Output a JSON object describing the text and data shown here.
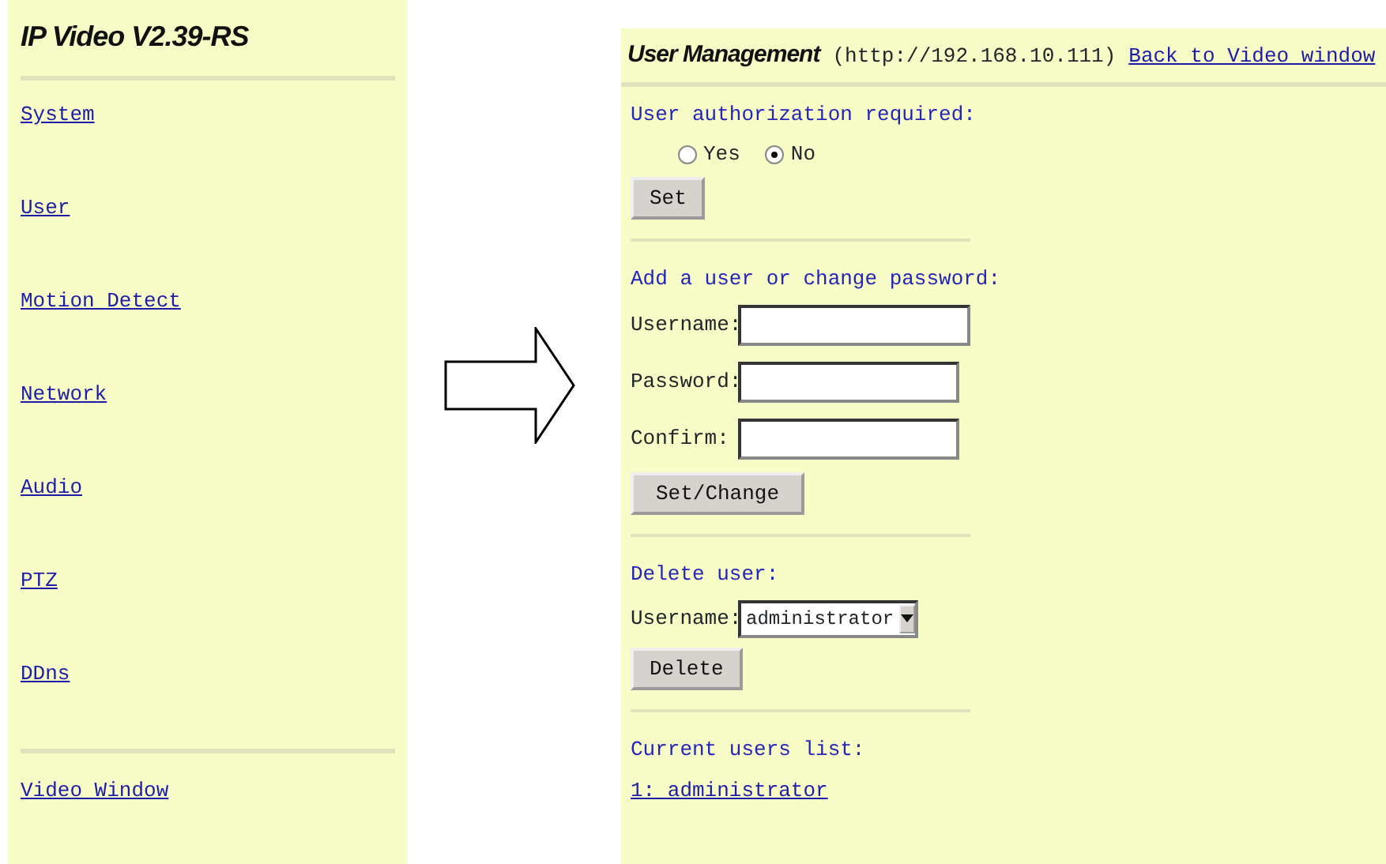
{
  "sidebar": {
    "title": "IP Video V2.39-RS",
    "items": [
      {
        "label": "System"
      },
      {
        "label": "User"
      },
      {
        "label": "Motion Detect"
      },
      {
        "label": "Network"
      },
      {
        "label": "Audio"
      },
      {
        "label": "PTZ"
      },
      {
        "label": "DDns"
      }
    ],
    "footer_link": "Video Window"
  },
  "page": {
    "title": "User Management",
    "url": "(http://192.168.10.111)",
    "back_link": "Back to Video window",
    "sections": [
      {
        "kind": "radio",
        "label": "User authorization required:",
        "options": [
          {
            "label": "Yes",
            "selected": false
          },
          {
            "label": "No",
            "selected": true
          }
        ],
        "button": "Set"
      },
      {
        "kind": "fields",
        "label": "Add a user or change password:",
        "fields": [
          {
            "label": "Username:"
          },
          {
            "label": "Password:"
          },
          {
            "label": "Confirm:"
          }
        ],
        "button": "Set/Change"
      },
      {
        "kind": "select",
        "label": "Delete user:",
        "field_label": "Username:",
        "value": "administrator",
        "button": "Delete"
      },
      {
        "kind": "list",
        "label": "Current users list:",
        "items": [
          "1: administrator"
        ]
      }
    ]
  }
}
